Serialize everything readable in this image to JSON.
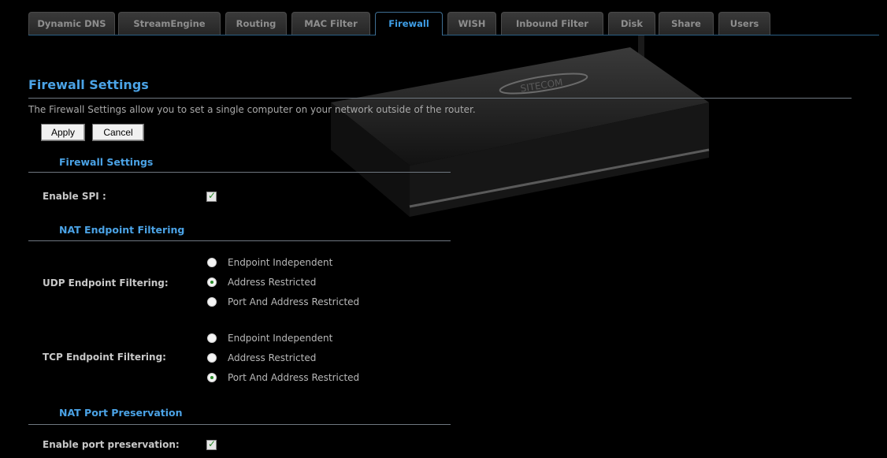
{
  "tabs": [
    {
      "label": "Dynamic DNS",
      "active": false
    },
    {
      "label": "StreamEngine",
      "active": false
    },
    {
      "label": "Routing",
      "active": false
    },
    {
      "label": "MAC Filter",
      "active": false
    },
    {
      "label": "Firewall",
      "active": true
    },
    {
      "label": "WISH",
      "active": false
    },
    {
      "label": "Inbound Filter",
      "active": false
    },
    {
      "label": "Disk",
      "active": false
    },
    {
      "label": "Share",
      "active": false
    },
    {
      "label": "Users",
      "active": false
    }
  ],
  "page": {
    "title": "Firewall Settings",
    "intro": "The Firewall Settings allow you to set a single computer on your network outside of the router.",
    "logo_text": "SITECOM"
  },
  "buttons": {
    "apply": "Apply",
    "cancel": "Cancel"
  },
  "firewall": {
    "heading": "Firewall Settings",
    "spi_label": "Enable SPI :",
    "spi_checked": true
  },
  "nat": {
    "heading": "NAT Endpoint Filtering",
    "udp_label": "UDP Endpoint Filtering:",
    "tcp_label": "TCP Endpoint Filtering:",
    "options": [
      "Endpoint Independent",
      "Address Restricted",
      "Port And Address Restricted"
    ],
    "udp_selected": "Address Restricted",
    "tcp_selected": "Port And Address Restricted"
  },
  "preservation": {
    "heading": "NAT Port Preservation",
    "label": "Enable port preservation:",
    "checked": true
  },
  "colors": {
    "accent": "#4ba3e6",
    "background": "#000000",
    "check": "#2a8a2a"
  }
}
